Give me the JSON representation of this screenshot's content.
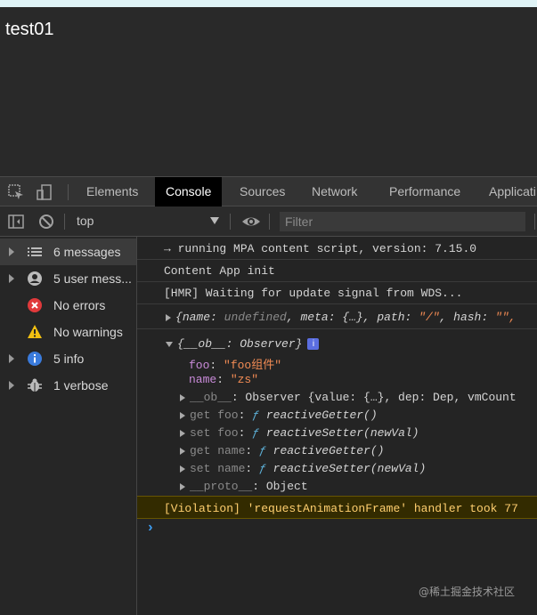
{
  "page": {
    "title": "test01"
  },
  "tabs": [
    {
      "label": "Elements"
    },
    {
      "label": "Console"
    },
    {
      "label": "Sources"
    },
    {
      "label": "Network"
    },
    {
      "label": "Performance"
    },
    {
      "label": "Applicati"
    }
  ],
  "toolbar": {
    "context": "top",
    "filter_placeholder": "Filter",
    "eye_icon": "eye-icon",
    "block_icon": "block-icon"
  },
  "sidebar": {
    "items": [
      {
        "label": "6 messages",
        "icon": "list-icon"
      },
      {
        "label": "5 user mess...",
        "icon": "user-icon"
      },
      {
        "label": "No errors",
        "icon": "error-icon"
      },
      {
        "label": "No warnings",
        "icon": "warning-icon"
      },
      {
        "label": "5 info",
        "icon": "info-icon"
      },
      {
        "label": "1 verbose",
        "icon": "bug-icon"
      }
    ]
  },
  "console": {
    "msg1": "→ running MPA content script, version: 7.15.0",
    "msg2": "Content App init",
    "msg3": "[HMR] Waiting for update signal from WDS...",
    "msg4": {
      "open": "{",
      "k1": "name",
      "v1": "undefined",
      "k2": "meta",
      "v2": "{…}",
      "k3": "path",
      "v3": "\"/\"",
      "k4": "hash",
      "v4": "\"\","
    },
    "obj": {
      "header_key": "{__ob__",
      "header_val": ": Observer}",
      "badge": "i",
      "foo_key": "foo",
      "foo_val": "\"foo组件\"",
      "name_key": "name",
      "name_val": "\"zs\"",
      "ob_key": "__ob__",
      "ob_val": ": Observer {value: {…}, dep: Dep, vmCount",
      "get_foo": "get foo",
      "get_foo_val": "reactiveGetter()",
      "set_foo": "set foo",
      "set_foo_val": "reactiveSetter(newVal)",
      "get_name": "get name",
      "get_name_val": "reactiveGetter()",
      "set_name": "set name",
      "set_name_val": "reactiveSetter(newVal)",
      "proto_key": "__proto__",
      "proto_val": ": Object",
      "f": "ƒ"
    },
    "violation": "[Violation] 'requestAnimationFrame' handler took 77",
    "prompt": "›"
  },
  "watermark": "@稀土掘金技术社区",
  "colors": {
    "accent": "#3d9cf0",
    "error": "#e0393b",
    "warning": "#f2c011",
    "info": "#3a7bdc"
  }
}
